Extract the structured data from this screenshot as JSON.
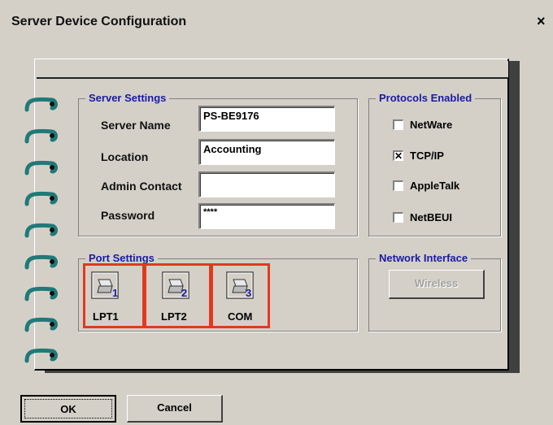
{
  "window": {
    "title": "Server Device Configuration",
    "close_label": "×"
  },
  "server_settings": {
    "title": "Server Settings",
    "server_name_label": "Server Name",
    "server_name_value": "PS-BE9176",
    "location_label": "Location",
    "location_value": "Accounting",
    "admin_contact_label": "Admin Contact",
    "admin_contact_value": "",
    "password_label": "Password",
    "password_value": "****"
  },
  "protocols": {
    "title": "Protocols Enabled",
    "items": [
      {
        "label": "NetWare",
        "checked": false
      },
      {
        "label": "TCP/IP",
        "checked": true
      },
      {
        "label": "AppleTalk",
        "checked": false
      },
      {
        "label": "NetBEUI",
        "checked": false
      }
    ]
  },
  "port_settings": {
    "title": "Port Settings",
    "ports": [
      {
        "label": "LPT1",
        "number": "1"
      },
      {
        "label": "LPT2",
        "number": "2"
      },
      {
        "label": "COM",
        "number": "3"
      }
    ],
    "highlight_color": "#e03a1e"
  },
  "network_interface": {
    "title": "Network Interface",
    "button_label": "Wireless"
  },
  "footer": {
    "ok_label": "OK",
    "cancel_label": "Cancel"
  },
  "colors": {
    "group_title": "#1a1aa6",
    "ring": "#1f7a78",
    "background": "#d4d0c8"
  }
}
